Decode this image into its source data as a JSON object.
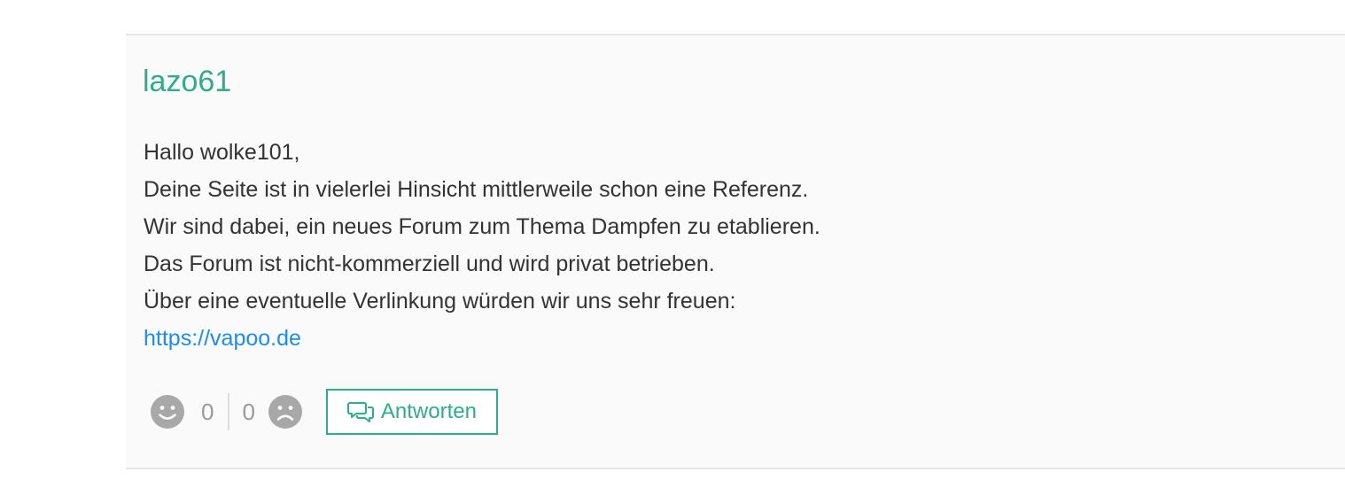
{
  "comment": {
    "author": "lazo61",
    "lines": [
      "Hallo wolke101,",
      "Deine Seite ist in vielerlei Hinsicht mittlerweile schon eine Referenz.",
      "Wir sind dabei, ein neues Forum zum Thema Dampfen zu etablieren.",
      "Das Forum ist nicht-kommerziell und wird privat betrieben.",
      "Über eine eventuelle Verlinkung würden wir uns sehr freuen:"
    ],
    "link": {
      "text": "https://vapoo.de",
      "href": "https://vapoo.de"
    },
    "likes": "0",
    "dislikes": "0",
    "reply_label": "Antworten"
  },
  "colors": {
    "accent": "#2fac8c",
    "link": "#1f8ce6",
    "icon": "#a8a8a8",
    "text": "#333333",
    "count": "#999999"
  },
  "icons": {
    "like": "smile-icon",
    "dislike": "frown-icon",
    "reply": "speech-bubbles-icon"
  }
}
